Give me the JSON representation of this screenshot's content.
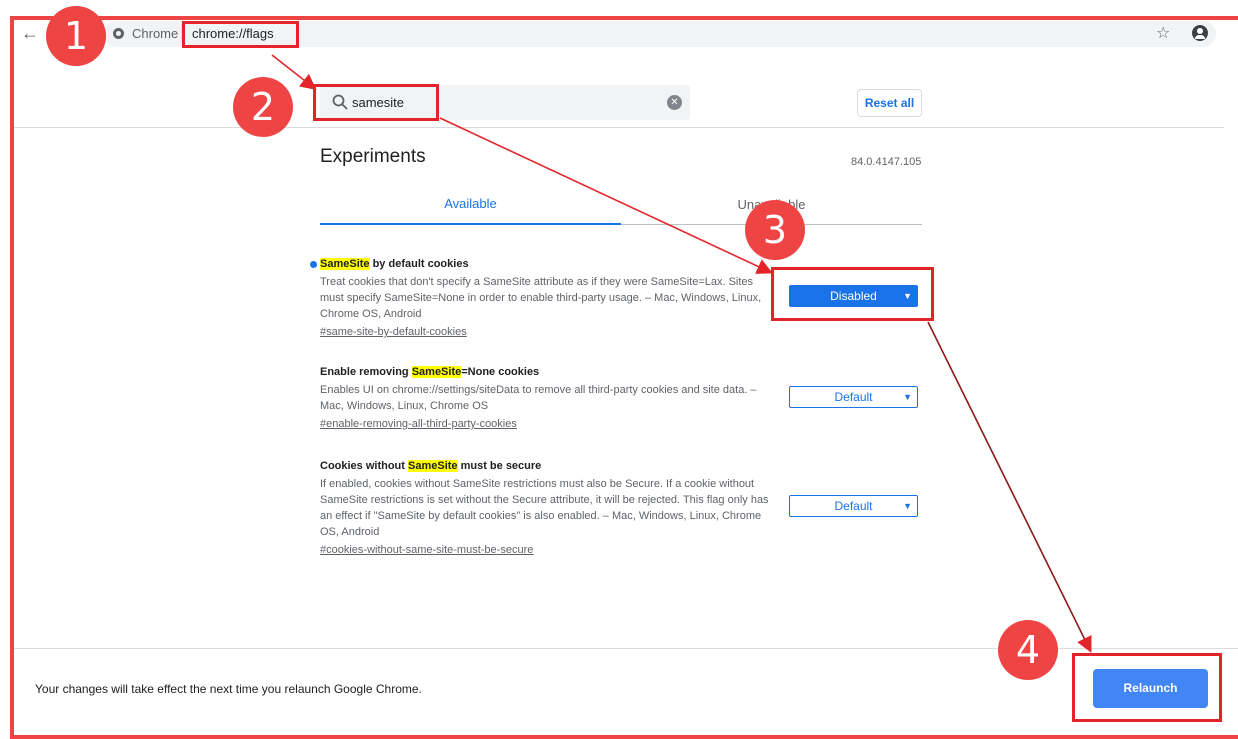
{
  "browser": {
    "origin_label": "Chrome",
    "url": "chrome://flags"
  },
  "header": {
    "search_value": "samesite",
    "reset_label": "Reset all"
  },
  "page": {
    "title": "Experiments",
    "version": "84.0.4147.105",
    "tabs": [
      {
        "label": "Available",
        "active": true
      },
      {
        "label": "Unavailable",
        "active": false
      }
    ]
  },
  "experiments": [
    {
      "title_hl": "SameSite",
      "title_rest": " by default cookies",
      "desc": "Treat cookies that don't specify a SameSite attribute as if they were SameSite=Lax. Sites must specify SameSite=None in order to enable third-party usage. – Mac, Windows, Linux, Chrome OS, Android",
      "link": "#same-site-by-default-cookies",
      "selected": "Disabled"
    },
    {
      "title_pre": "Enable removing ",
      "title_hl": "SameSite",
      "title_rest": "=None cookies",
      "desc": "Enables UI on chrome://settings/siteData to remove all third-party cookies and site data. – Mac, Windows, Linux, Chrome OS",
      "link": "#enable-removing-all-third-party-cookies",
      "selected": "Default"
    },
    {
      "title_pre": "Cookies without ",
      "title_hl": "SameSite",
      "title_rest": " must be secure",
      "desc": "If enabled, cookies without SameSite restrictions must also be Secure. If a cookie without SameSite restrictions is set without the Secure attribute, it will be rejected. This flag only has an effect if \"SameSite by default cookies\" is also enabled. – Mac, Windows, Linux, Chrome OS, Android",
      "link": "#cookies-without-same-site-must-be-secure",
      "selected": "Default"
    }
  ],
  "footer": {
    "notice": "Your changes will take effect the next time you relaunch Google Chrome.",
    "relaunch_label": "Relaunch"
  },
  "annotations": {
    "steps": [
      "1",
      "2",
      "3",
      "4"
    ],
    "color": "#e3242b"
  },
  "icons": {
    "back": "arrow-left-icon",
    "star": "star-icon",
    "account": "account-circle-icon",
    "search": "search-icon",
    "clear": "clear-icon",
    "dropdown": "chevron-down-icon"
  }
}
